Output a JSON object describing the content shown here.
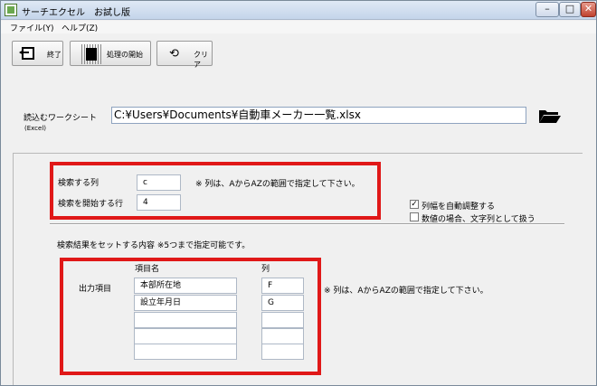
{
  "window": {
    "title": "サーチエクセル　お試し版"
  },
  "titlebar_buttons": {
    "minimize": "–",
    "maximize": "□",
    "close": "✕"
  },
  "menu": [
    "ファイル(Y)",
    "ヘルプ(Z)"
  ],
  "toolbar": {
    "exit_label": "終了",
    "start_label": "処理の開始",
    "clear_label": "クリア"
  },
  "workbook": {
    "label": "読込むワークシート",
    "sublabel": "(Excel)",
    "path": "C:¥Users¥Documents¥自動車メーカー一覧.xlsx"
  },
  "search": {
    "column_label": "検索する列",
    "column_value": "c",
    "start_row_label": "検索を開始する行",
    "start_row_value": "4",
    "note": "※ 列は、AからAZの範囲で指定して下さい。"
  },
  "options": {
    "autofit_label": "列幅を自動調整する",
    "autofit_checked": true,
    "number_as_text_label": "数値の場合、文字列として扱う",
    "number_as_text_checked": false
  },
  "output": {
    "section_label": "検索結果をセットする内容 ※5つまで指定可能です。",
    "items_label": "出力項目",
    "name_header": "項目名",
    "col_header": "列",
    "note": "※ 列は、AからAZの範囲で指定して下さい。",
    "rows": [
      {
        "name": "本部所在地",
        "col": "F"
      },
      {
        "name": "設立年月日",
        "col": "G"
      },
      {
        "name": "",
        "col": ""
      },
      {
        "name": "",
        "col": ""
      },
      {
        "name": "",
        "col": ""
      }
    ]
  }
}
